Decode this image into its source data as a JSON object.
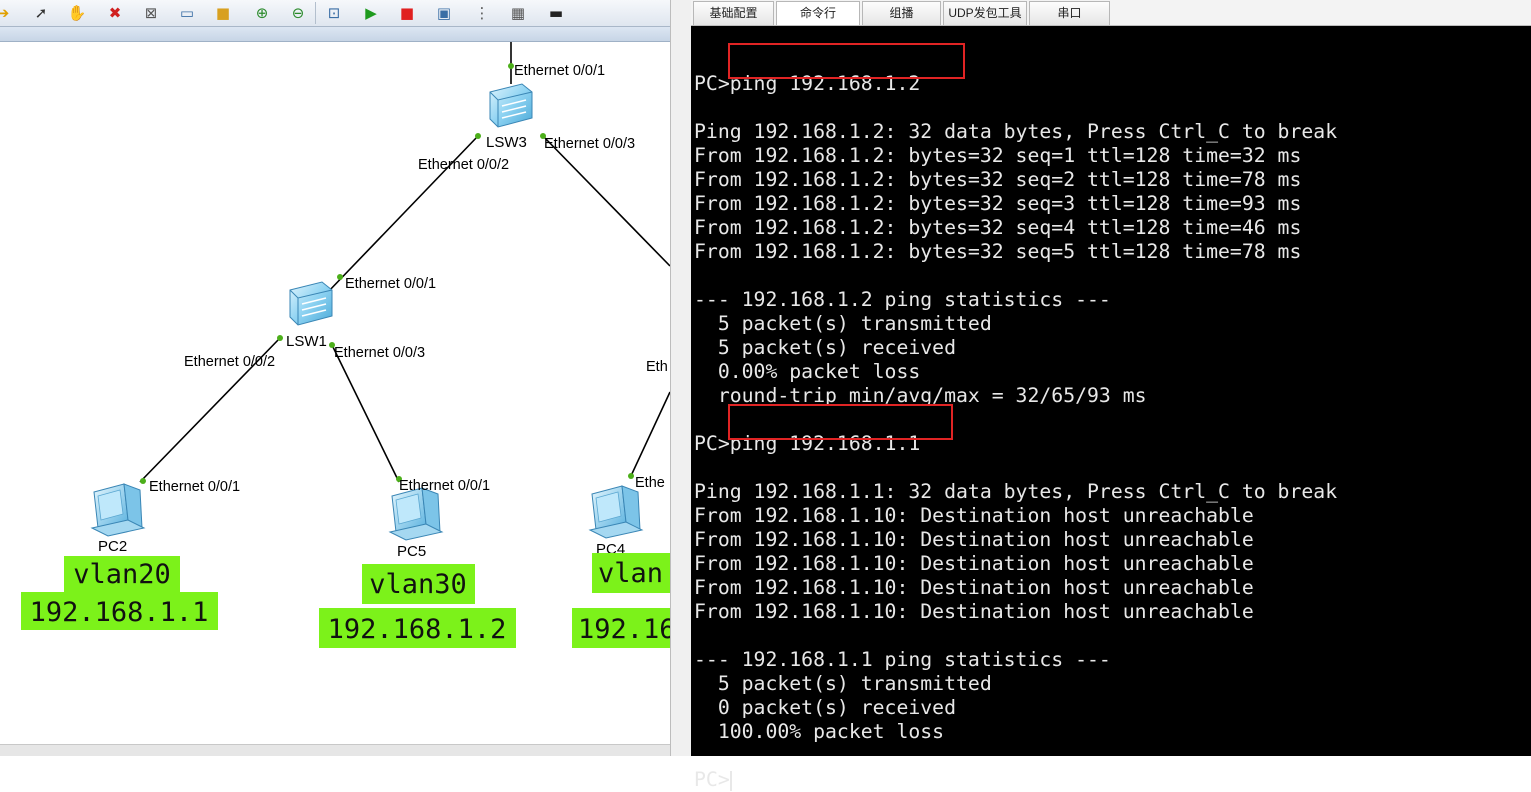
{
  "tabs": [
    "基础配置",
    "命令行",
    "组播",
    "UDP发包工具",
    "串口"
  ],
  "toolbar_icons": [
    "arrow-right-icon",
    "pointer-icon",
    "hand-icon",
    "delete-icon",
    "delete-link-icon",
    "text-note-icon",
    "rectangle-icon",
    "zoom-in-icon",
    "zoom-out-icon",
    "fit-icon",
    "start-icon",
    "stop-icon",
    "capture-icon",
    "topology-icon",
    "grid-icon",
    "console-icon"
  ],
  "topology": {
    "devices": {
      "lsw3": "LSW3",
      "lsw1": "LSW1",
      "pc2": "PC2",
      "pc5": "PC5",
      "pc4": "PC4"
    },
    "ports": {
      "lsw3_top": "Ethernet 0/0/1",
      "lsw3_left": "Ethernet 0/0/2",
      "lsw3_right": "Ethernet 0/0/3",
      "lsw1_top": "Ethernet 0/0/1",
      "lsw1_left": "Ethernet 0/0/2",
      "lsw1_right": "Ethernet 0/0/3",
      "pc2_port": "Ethernet 0/0/1",
      "pc5_port": "Ethernet 0/0/1",
      "pc4_port": "Ethe",
      "right_switch_port": "Eth"
    },
    "labels": {
      "pc2_vlan": "vlan20",
      "pc2_ip": "192.168.1.1",
      "pc5_vlan": "vlan30",
      "pc5_ip": "192.168.1.2",
      "pc4_vlan": "vlan",
      "pc4_ip": "192.16"
    },
    "colors": {
      "label_bg": "#7cf21a",
      "link": "#000000",
      "port_dot": "#4caf1a"
    }
  },
  "terminal": {
    "lines": [
      "",
      "PC>ping 192.168.1.2",
      "",
      "Ping 192.168.1.2: 32 data bytes, Press Ctrl_C to break",
      "From 192.168.1.2: bytes=32 seq=1 ttl=128 time=32 ms",
      "From 192.168.1.2: bytes=32 seq=2 ttl=128 time=78 ms",
      "From 192.168.1.2: bytes=32 seq=3 ttl=128 time=93 ms",
      "From 192.168.1.2: bytes=32 seq=4 ttl=128 time=46 ms",
      "From 192.168.1.2: bytes=32 seq=5 ttl=128 time=78 ms",
      "",
      "--- 192.168.1.2 ping statistics ---",
      "  5 packet(s) transmitted",
      "  5 packet(s) received",
      "  0.00% packet loss",
      "  round-trip min/avg/max = 32/65/93 ms",
      "",
      "PC>ping 192.168.1.1",
      "",
      "Ping 192.168.1.1: 32 data bytes, Press Ctrl_C to break",
      "From 192.168.1.10: Destination host unreachable",
      "From 192.168.1.10: Destination host unreachable",
      "From 192.168.1.10: Destination host unreachable",
      "From 192.168.1.10: Destination host unreachable",
      "From 192.168.1.10: Destination host unreachable",
      "",
      "--- 192.168.1.1 ping statistics ---",
      "  5 packet(s) transmitted",
      "  0 packet(s) received",
      "  100.00% packet loss",
      "",
      "PC>"
    ],
    "colors": {
      "background": "#000000",
      "text": "#e8e8e8",
      "highlight": "#e02424"
    }
  }
}
